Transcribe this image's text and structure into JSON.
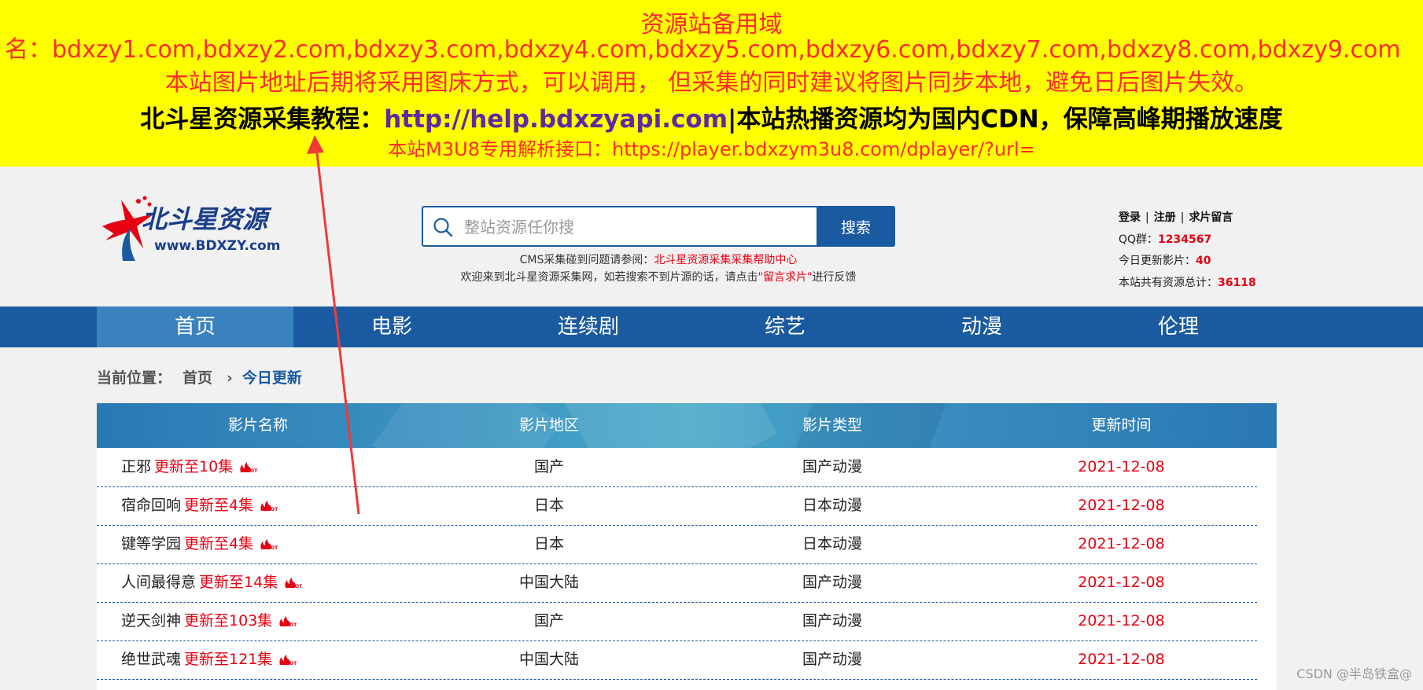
{
  "notice": {
    "line1": "资源站备用域",
    "line2": "名：bdxzy1.com,bdxzy2.com,bdxzy3.com,bdxzy4.com,bdxzy5.com,bdxzy6.com,bdxzy7.com,bdxzy8.com,bdxzy9.com",
    "line3": "本站图片地址后期将采用图床方式，可以调用， 但采集的同时建议将图片同步本地，避免日后图片失效。",
    "line4_prefix": "北斗星资源采集教程：",
    "line4_url": "http://help.bdxzyapi.com",
    "line4_suffix": "|本站热播资源均为国内CDN，保障高峰期播放速度",
    "line5": "本站M3U8专用解析接口：https://player.bdxzym3u8.com/dplayer/?url="
  },
  "logo": {
    "cn": "北斗星资源",
    "en": "www.BDXZY.com"
  },
  "search": {
    "placeholder": "整站资源任你搜",
    "button": "搜索"
  },
  "help": {
    "prefix": "CMS采集碰到问题请参阅：",
    "link": "北斗星资源采集采集帮助中心",
    "welcome_prefix": "欢迎来到北斗星资源采集网，如若搜索不到片源的话，请点击",
    "welcome_link": "\"留言求片\"",
    "welcome_suffix": "进行反馈"
  },
  "user": {
    "login": "登录",
    "register": "注册",
    "request": "求片留言",
    "sep": "|"
  },
  "stats": {
    "qq_label": "QQ群：",
    "qq_value": "1234567",
    "today_label": "今日更新影片：",
    "today_value": "40",
    "total_label": "本站共有资源总计：",
    "total_value": "36118"
  },
  "nav": [
    "首页",
    "电影",
    "连续剧",
    "综艺",
    "动漫",
    "伦理"
  ],
  "breadcrumb": {
    "label": "当前位置：",
    "home": "首页",
    "chevron": "›",
    "current": "今日更新"
  },
  "table": {
    "headers": [
      "影片名称",
      "影片地区",
      "影片类型",
      "更新时间"
    ],
    "rows": [
      {
        "name": "正邪",
        "update": "更新至10集",
        "region": "国产",
        "type": "国产动漫",
        "date": "2021-12-08"
      },
      {
        "name": "宿命回响",
        "update": "更新至4集",
        "region": "日本",
        "type": "日本动漫",
        "date": "2021-12-08"
      },
      {
        "name": "键等学园",
        "update": "更新至4集",
        "region": "日本",
        "type": "日本动漫",
        "date": "2021-12-08"
      },
      {
        "name": "人间最得意",
        "update": "更新至14集",
        "region": "中国大陆",
        "type": "国产动漫",
        "date": "2021-12-08"
      },
      {
        "name": "逆天剑神",
        "update": "更新至103集",
        "region": "国产",
        "type": "国产动漫",
        "date": "2021-12-08"
      },
      {
        "name": "绝世武魂",
        "update": "更新至121集",
        "region": "中国大陆",
        "type": "国产动漫",
        "date": "2021-12-08"
      }
    ]
  },
  "watermark": "CSDN @半岛铁盒@",
  "colors": {
    "banner": "#ffff00",
    "brand_blue": "#1a5aa0",
    "accent_red": "#e60012"
  }
}
